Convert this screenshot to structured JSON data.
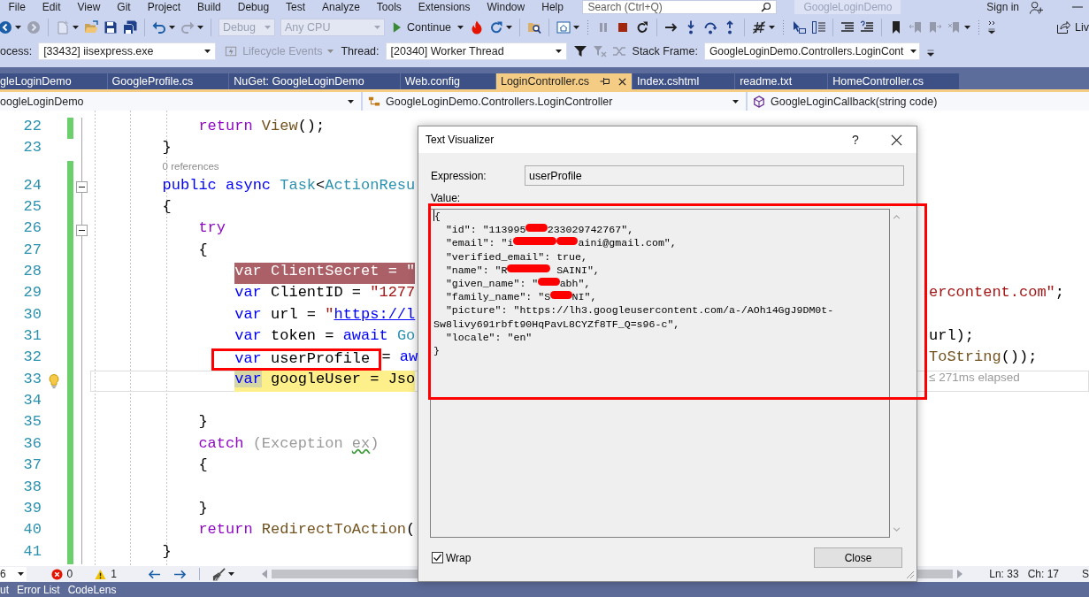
{
  "menu_bar": {
    "items": [
      "File",
      "Edit",
      "View",
      "Git",
      "Project",
      "Build",
      "Debug",
      "Test",
      "Analyze",
      "Tools",
      "Extensions",
      "Window",
      "Help"
    ],
    "search": {
      "placeholder": "Search (Ctrl+Q)"
    },
    "solution_name": "GoogleLoginDemo",
    "sign_in": "Sign in"
  },
  "toolbar_main": [
    {
      "kind": "icon",
      "disabled": false
    },
    {
      "kind": "caret"
    },
    {
      "kind": "icon",
      "disabled": true
    },
    {
      "kind": "separator"
    },
    {
      "kind": "icon",
      "disabled": true
    },
    {
      "kind": "caret"
    },
    {
      "kind": "icon",
      "disabled": false
    },
    {
      "kind": "icon",
      "disabled": false
    },
    {
      "kind": "icon",
      "disabled": false
    },
    {
      "kind": "separator"
    },
    {
      "kind": "icon",
      "disabled": false
    },
    {
      "kind": "caret"
    },
    {
      "kind": "icon",
      "disabled": true
    },
    {
      "kind": "caret"
    },
    {
      "kind": "separator"
    },
    {
      "kind": "dropdown",
      "value": "Debug",
      "disabled": true
    },
    {
      "kind": "dropdown",
      "value": "Any CPU",
      "disabled": true
    },
    {
      "kind": "button",
      "label": "Continue"
    },
    {
      "kind": "icon",
      "disabled": false
    },
    {
      "kind": "icon",
      "disabled": false
    },
    {
      "kind": "caret"
    },
    {
      "kind": "separator"
    },
    {
      "kind": "icon",
      "disabled": false
    },
    {
      "kind": "separator"
    },
    {
      "kind": "icon",
      "disabled": false
    },
    {
      "kind": "caret"
    },
    {
      "kind": "grip"
    },
    {
      "kind": "icon",
      "disabled": true
    },
    {
      "kind": "icon",
      "disabled": false
    },
    {
      "kind": "icon",
      "disabled": false
    },
    {
      "kind": "separator"
    },
    {
      "kind": "icon",
      "disabled": false
    },
    {
      "kind": "icon",
      "disabled": false
    },
    {
      "kind": "icon",
      "disabled": false
    },
    {
      "kind": "icon",
      "disabled": false
    },
    {
      "kind": "separator"
    },
    {
      "kind": "icon",
      "disabled": false
    },
    {
      "kind": "caret"
    },
    {
      "kind": "grip"
    },
    {
      "kind": "icon",
      "disabled": false
    },
    {
      "kind": "icon",
      "disabled": false
    },
    {
      "kind": "separator"
    },
    {
      "kind": "icon",
      "disabled": false
    },
    {
      "kind": "icon",
      "disabled": false
    },
    {
      "kind": "separator"
    },
    {
      "kind": "icon",
      "disabled": false
    },
    {
      "kind": "icon",
      "disabled": true
    },
    {
      "kind": "icon",
      "disabled": true
    },
    {
      "kind": "icon",
      "disabled": true
    },
    {
      "kind": "caret"
    },
    {
      "kind": "grip"
    },
    {
      "kind": "overflow"
    }
  ],
  "live_share": "Liv",
  "debug_location": {
    "process_label": "ocess:",
    "process": "[33432] iisexpress.exe",
    "lifecycle_events": {
      "label": "Lifecycle Events",
      "disabled": true
    },
    "thread_label": "Thread:",
    "thread": "[20340] Worker Thread",
    "thread_tools": [
      {
        "disabled": false
      },
      {
        "disabled": true
      },
      {
        "disabled": true
      }
    ],
    "stack_frame_label": "Stack Frame:",
    "stack_frame": "GoogleLoginDemo.Controllers.LoginCont"
  },
  "tabs": [
    {
      "label": "gleLoginDemo",
      "selected": false
    },
    {
      "label": "GoogleProfile.cs",
      "selected": false
    },
    {
      "label": "NuGet: GoogleLoginDemo",
      "selected": false
    },
    {
      "label": "Web.config",
      "selected": false
    },
    {
      "label": "LoginController.cs",
      "selected": true
    },
    {
      "label": "Index.cshtml",
      "selected": false
    },
    {
      "label": "readme.txt",
      "selected": false
    },
    {
      "label": "HomeController.cs",
      "selected": false
    }
  ],
  "navigation_bar": [
    {
      "kind": "project",
      "text": "oogleLoginDemo"
    },
    {
      "kind": "class",
      "text": "GoogleLoginDemo.Controllers.LoginController"
    },
    {
      "kind": "method",
      "text": "GoogleLoginCallback(string code)"
    }
  ],
  "editor": {
    "lines": [
      {
        "children": [
          {
            "number": "22",
            "changed": true,
            "tokens": [
              {
                "kind": "control",
                "text": "return "
              },
              {
                "kind": "method",
                "text": "View"
              },
              {
                "kind": "plain",
                "text": "();"
              }
            ]
          }
        ]
      },
      {
        "number": "23",
        "changed": false,
        "tokens": [
          {
            "kind": "plain",
            "text": "}"
          }
        ]
      },
      {
        "number": "24",
        "changed": true,
        "codelens": "0 references",
        "expanded": true,
        "tokens": [
          {
            "kind": "keyword",
            "text": "public async "
          },
          {
            "kind": "type",
            "text": "Task"
          },
          {
            "kind": "plain",
            "text": "<"
          },
          {
            "kind": "type",
            "text": "ActionResu"
          }
        ]
      },
      {
        "number": "25",
        "changed": true,
        "tokens": [
          {
            "kind": "plain",
            "text": "{"
          }
        ],
        "children": [
          {
            "number": "26",
            "changed": true,
            "expanded": true,
            "tokens": [
              {
                "kind": "control",
                "text": "try"
              }
            ]
          },
          {
            "number": "27",
            "changed": true,
            "tokens": [
              {
                "kind": "plain",
                "text": "{"
              }
            ],
            "children": [
              {
                "number": "28",
                "changed": true,
                "breakpoint": true,
                "tokens": [
                  {
                    "kind": "keyword",
                    "text": "var"
                  },
                  {
                    "kind": "plain",
                    "text": " ClientSecret = "
                  },
                  {
                    "kind": "string",
                    "text": "\""
                  }
                ]
              },
              {
                "number": "29",
                "changed": true,
                "tokens": [
                  {
                    "kind": "keyword",
                    "text": "var"
                  },
                  {
                    "kind": "plain",
                    "text": " ClientID = "
                  },
                  {
                    "kind": "string",
                    "text": "\"1277"
                  }
                ],
                "tail": [
                  {
                    "kind": "string",
                    "text": "ercontent.com\""
                  },
                  {
                    "kind": "plain",
                    "text": ";"
                  }
                ]
              },
              {
                "number": "30",
                "changed": true,
                "tokens": [
                  {
                    "kind": "keyword",
                    "text": "var"
                  },
                  {
                    "kind": "plain",
                    "text": " url = "
                  },
                  {
                    "kind": "string",
                    "text": "\""
                  },
                  {
                    "kind": "link",
                    "text": "https://l"
                  }
                ]
              },
              {
                "number": "31",
                "changed": true,
                "tokens": [
                  {
                    "kind": "keyword",
                    "text": "var"
                  },
                  {
                    "kind": "plain",
                    "text": " token = "
                  },
                  {
                    "kind": "keyword",
                    "text": "await "
                  },
                  {
                    "kind": "type",
                    "text": "Go"
                  }
                ],
                "tail": [
                  {
                    "kind": "plain",
                    "text": "url);"
                  }
                ]
              },
              {
                "number": "32",
                "changed": true,
                "tokens": [
                  {
                    "kind": "keyword",
                    "text": "var",
                    "boxed": true
                  },
                  {
                    "kind": "plain",
                    "text": " userProfile ",
                    "boxed": true
                  },
                  {
                    "kind": "plain",
                    "text": "= "
                  },
                  {
                    "kind": "keyword",
                    "text": "aw"
                  }
                ],
                "tail": [
                  {
                    "kind": "method",
                    "text": "ToString"
                  },
                  {
                    "kind": "plain",
                    "text": "());"
                  }
                ]
              },
              {
                "number": "33",
                "changed": true,
                "current": true,
                "lightbulb": true,
                "tokens": [
                  {
                    "kind": "keyword",
                    "text": "var",
                    "marked": true
                  },
                  {
                    "kind": "plain",
                    "text": " googleUser = Jso"
                  }
                ],
                "perf_tip": "≤ 271ms elapsed"
              },
              {
                "number": "34",
                "changed": true
              }
            ]
          },
          {
            "number": "35",
            "changed": true,
            "tokens": [
              {
                "kind": "plain",
                "text": "}"
              }
            ]
          },
          {
            "number": "36",
            "changed": true,
            "tokens": [
              {
                "kind": "control",
                "text": "catch "
              },
              {
                "kind": "dim",
                "text": "(Exception "
              },
              {
                "kind": "warning",
                "text": "ex"
              },
              {
                "kind": "dim",
                "text": ")"
              }
            ]
          },
          {
            "number": "37",
            "changed": true,
            "tokens": [
              {
                "kind": "plain",
                "text": "{"
              }
            ],
            "children": [
              {
                "number": "38",
                "changed": true
              }
            ]
          },
          {
            "number": "39",
            "changed": true,
            "tokens": [
              {
                "kind": "plain",
                "text": "}"
              }
            ]
          },
          {
            "number": "40",
            "changed": true,
            "tokens": [
              {
                "kind": "control",
                "text": "return "
              },
              {
                "kind": "method",
                "text": "RedirectToAction"
              },
              {
                "kind": "plain",
                "text": "("
              }
            ]
          }
        ]
      },
      {
        "number": "41",
        "changed": true,
        "tokens": [
          {
            "kind": "plain",
            "text": "}"
          }
        ]
      }
    ]
  },
  "text_visualizer": {
    "title": "Text Visualizer",
    "help": "?",
    "expression_label": "Expression:",
    "expression": "userProfile",
    "value_label": "Value:",
    "value": {
      "annotated": true,
      "lines": [
        {
          "cursor": true,
          "segments": [
            {
              "kind": "text",
              "text": "{"
            }
          ]
        },
        {
          "children": [
            {
              "segments": [
                {
                  "kind": "text",
                  "text": "\"id\": \"113995"
                },
                {
                  "kind": "redaction",
                  "long": false
                },
                {
                  "kind": "text",
                  "text": "233029742767\","
                }
              ]
            },
            {
              "segments": [
                {
                  "kind": "text",
                  "text": "\"email\": \"i"
                },
                {
                  "kind": "redaction",
                  "long": true
                },
                {
                  "kind": "redaction",
                  "long": false
                },
                {
                  "kind": "text",
                  "text": "aini@gmail.com\","
                }
              ]
            },
            {
              "segments": [
                {
                  "kind": "text",
                  "text": "\"verified_email\": true,"
                }
              ]
            },
            {
              "segments": [
                {
                  "kind": "text",
                  "text": "\"name\": \"R"
                },
                {
                  "kind": "redaction",
                  "long": true
                },
                {
                  "kind": "text",
                  "text": " SAINI\","
                }
              ]
            },
            {
              "segments": [
                {
                  "kind": "text",
                  "text": "\"given_name\": \""
                },
                {
                  "kind": "redaction",
                  "long": false
                },
                {
                  "kind": "text",
                  "text": "abh\","
                }
              ]
            },
            {
              "segments": [
                {
                  "kind": "text",
                  "text": "\"family_name\": \"S"
                },
                {
                  "kind": "redaction",
                  "long": false
                },
                {
                  "kind": "text",
                  "text": "NI\","
                }
              ]
            },
            {
              "segments": [
                {
                  "kind": "text",
                  "text": "\"picture\": \"https://lh3.googleusercontent.com/a-/AOh14GgJ9DM0t-Sw8livy691rbft90HqPavL8CYZf8TF_Q=s96-c\","
                }
              ]
            },
            {
              "segments": [
                {
                  "kind": "text",
                  "text": "\"locale\": \"en\""
                }
              ]
            }
          ]
        },
        {
          "segments": [
            {
              "kind": "text",
              "text": "}"
            }
          ]
        }
      ]
    },
    "wrap": {
      "label": "Wrap",
      "checked": true
    },
    "close_button": "Close"
  },
  "status_bar": {
    "zoom": "6",
    "errors": "0",
    "warnings": "1",
    "line": "Ln: 33",
    "column": "Ch: 17",
    "field_3": "S"
  },
  "tool_windows": [
    "ut",
    "Error List",
    "CodeLens"
  ]
}
